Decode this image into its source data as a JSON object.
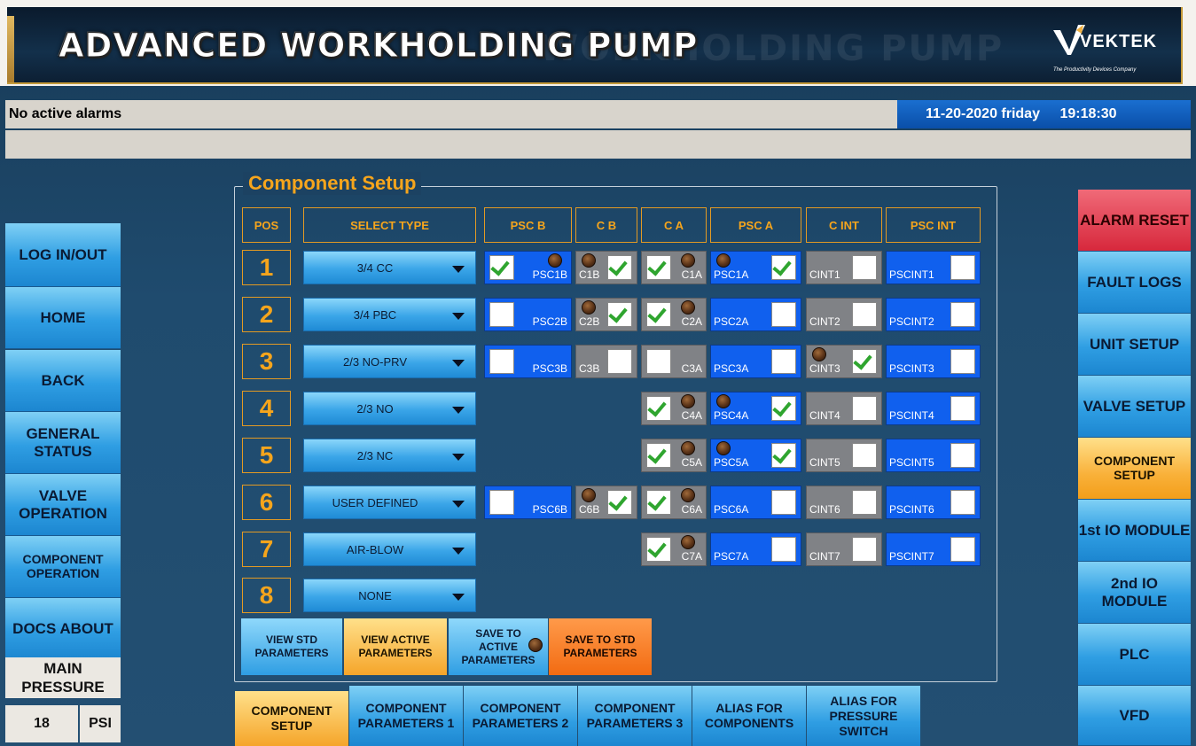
{
  "header": {
    "title": "ADVANCED WORKHOLDING PUMP",
    "title_ghost": "WORKHOLDING PUMP",
    "logo_text": "VEKTEK",
    "logo_tagline": "The Productivity Devices Company"
  },
  "alarm": {
    "text": "No active alarms"
  },
  "datetime": {
    "date": "11-20-2020 friday",
    "time": "19:18:30"
  },
  "left_nav": [
    "LOG IN/OUT",
    "HOME",
    "BACK",
    "GENERAL STATUS",
    "VALVE OPERATION",
    "COMPONENT OPERATION",
    "DOCS ABOUT"
  ],
  "pressure": {
    "label": "MAIN PRESSURE",
    "value": "18",
    "unit": "PSI"
  },
  "right_nav": [
    "ALARM RESET",
    "FAULT LOGS",
    "UNIT SETUP",
    "VALVE SETUP",
    "COMPONENT SETUP",
    "1st IO MODULE",
    "2nd IO MODULE",
    "PLC",
    "VFD"
  ],
  "panel": {
    "title": "Component Setup"
  },
  "columns": [
    "POS",
    "SELECT TYPE",
    "PSC B",
    "C B",
    "C A",
    "PSC A",
    "C INT",
    "PSC INT"
  ],
  "rows": [
    {
      "pos": "1",
      "type": "3/4 CC",
      "pscb": {
        "label": "PSC1B",
        "checked": true,
        "lamp": true
      },
      "cb": {
        "label": "C1B",
        "checked": true,
        "lamp": true
      },
      "ca": {
        "label": "C1A",
        "checked": true,
        "lamp": true
      },
      "psca": {
        "label": "PSC1A",
        "checked": true,
        "lamp": true
      },
      "cint": {
        "label": "CINT1",
        "checked": false,
        "lamp": false
      },
      "pscint": {
        "label": "PSCINT1",
        "checked": false,
        "lamp": false
      }
    },
    {
      "pos": "2",
      "type": "3/4 PBC",
      "pscb": {
        "label": "PSC2B",
        "checked": false,
        "lamp": false
      },
      "cb": {
        "label": "C2B",
        "checked": true,
        "lamp": true
      },
      "ca": {
        "label": "C2A",
        "checked": true,
        "lamp": true
      },
      "psca": {
        "label": "PSC2A",
        "checked": false,
        "lamp": false
      },
      "cint": {
        "label": "CINT2",
        "checked": false,
        "lamp": false
      },
      "pscint": {
        "label": "PSCINT2",
        "checked": false,
        "lamp": false
      }
    },
    {
      "pos": "3",
      "type": "2/3 NO-PRV",
      "pscb": {
        "label": "PSC3B",
        "checked": false,
        "lamp": false
      },
      "cb": {
        "label": "C3B",
        "checked": false,
        "lamp": false
      },
      "ca": {
        "label": "C3A",
        "checked": false,
        "lamp": false
      },
      "psca": {
        "label": "PSC3A",
        "checked": false,
        "lamp": false
      },
      "cint": {
        "label": "CINT3",
        "checked": true,
        "lamp": true
      },
      "pscint": {
        "label": "PSCINT3",
        "checked": false,
        "lamp": false
      }
    },
    {
      "pos": "4",
      "type": "2/3 NO",
      "ca": {
        "label": "C4A",
        "checked": true,
        "lamp": true
      },
      "psca": {
        "label": "PSC4A",
        "checked": true,
        "lamp": true
      },
      "cint": {
        "label": "CINT4",
        "checked": false,
        "lamp": false
      },
      "pscint": {
        "label": "PSCINT4",
        "checked": false,
        "lamp": false
      }
    },
    {
      "pos": "5",
      "type": "2/3 NC",
      "ca": {
        "label": "C5A",
        "checked": true,
        "lamp": true
      },
      "psca": {
        "label": "PSC5A",
        "checked": true,
        "lamp": true
      },
      "cint": {
        "label": "CINT5",
        "checked": false,
        "lamp": false
      },
      "pscint": {
        "label": "PSCINT5",
        "checked": false,
        "lamp": false
      }
    },
    {
      "pos": "6",
      "type": "USER DEFINED",
      "pscb": {
        "label": "PSC6B",
        "checked": false,
        "lamp": false
      },
      "cb": {
        "label": "C6B",
        "checked": true,
        "lamp": true
      },
      "ca": {
        "label": "C6A",
        "checked": true,
        "lamp": true
      },
      "psca": {
        "label": "PSC6A",
        "checked": false,
        "lamp": false
      },
      "cint": {
        "label": "CINT6",
        "checked": false,
        "lamp": false
      },
      "pscint": {
        "label": "PSCINT6",
        "checked": false,
        "lamp": false
      }
    },
    {
      "pos": "7",
      "type": "AIR-BLOW",
      "ca": {
        "label": "C7A",
        "checked": true,
        "lamp": true
      },
      "psca": {
        "label": "PSC7A",
        "checked": false,
        "lamp": false
      },
      "cint": {
        "label": "CINT7",
        "checked": false,
        "lamp": false
      },
      "pscint": {
        "label": "PSCINT7",
        "checked": false,
        "lamp": false
      }
    },
    {
      "pos": "8",
      "type": "NONE"
    }
  ],
  "actions": [
    {
      "label": "VIEW STD PARAMETERS",
      "style": "blue"
    },
    {
      "label": "VIEW ACTIVE PARAMETERS",
      "style": "yellow"
    },
    {
      "label": "SAVE TO ACTIVE PARAMETERS",
      "style": "blue"
    },
    {
      "label": "SAVE TO STD PARAMETERS",
      "style": "orange"
    }
  ],
  "tabs": [
    "COMPONENT SETUP",
    "COMPONENT PARAMETERS 1",
    "COMPONENT PARAMETERS 2",
    "COMPONENT PARAMETERS 3",
    "ALIAS FOR COMPONENTS",
    "ALIAS FOR PRESSURE SWITCH"
  ],
  "colors": {
    "accent_orange": "#f6a51c",
    "active_yellow": "#f5a52a",
    "cell_blue": "#1060ee",
    "cell_gray": "#808286",
    "alarm_red": "#d7283c"
  }
}
